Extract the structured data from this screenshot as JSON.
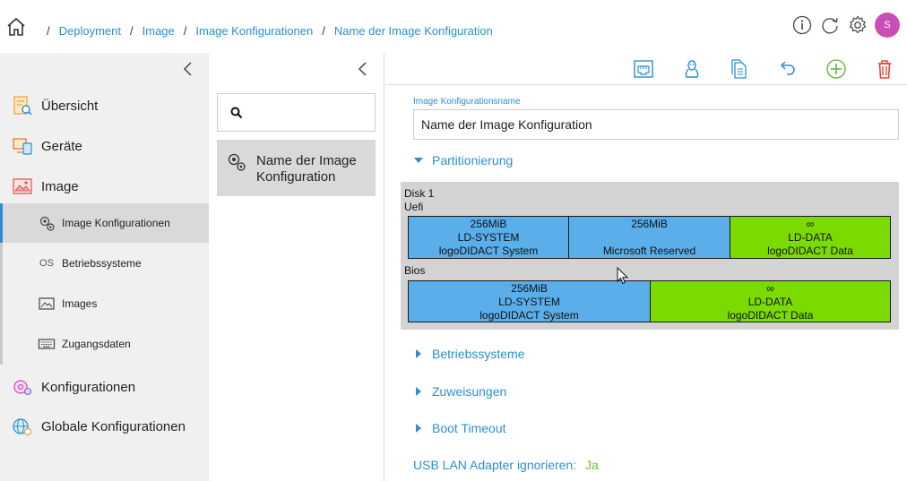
{
  "breadcrumb": {
    "items": [
      "Deployment",
      "Image",
      "Image Konfigurationen",
      "Name der Image Konfiguration"
    ],
    "separator": "/"
  },
  "header": {
    "avatar_initial": "S",
    "avatar_color": "#c94fb6"
  },
  "sidebar": {
    "items": [
      {
        "label": "Übersicht",
        "icon": "overview-icon"
      },
      {
        "label": "Geräte",
        "icon": "devices-icon"
      },
      {
        "label": "Image",
        "icon": "image-icon"
      },
      {
        "label": "Konfigurationen",
        "icon": "configurations-icon"
      },
      {
        "label": "Globale Konfigurationen",
        "icon": "global-configurations-icon"
      }
    ],
    "subitems": [
      {
        "label": "Image Konfigurationen",
        "icon": "gears-icon",
        "active": true
      },
      {
        "label": "Betriebssysteme",
        "icon_text": "OS"
      },
      {
        "label": "Images",
        "icon": "picture-icon"
      },
      {
        "label": "Zugangsdaten",
        "icon": "keyboard-icon"
      }
    ]
  },
  "middle": {
    "search_value": "",
    "list_item": "Name der Image Konfiguration"
  },
  "form": {
    "name_label": "Image Konfigurationsname",
    "name_value": "Name der Image Konfiguration",
    "sections": {
      "partitioning": "Partitionierung",
      "os": "Betriebssysteme",
      "assignments": "Zuweisungen",
      "boot_timeout": "Boot Timeout"
    },
    "usb_label": "USB LAN Adapter ignorieren:",
    "usb_value": "Ja"
  },
  "partitions": {
    "disk_label": "Disk 1",
    "uefi_label": "Uefi",
    "bios_label": "Bios",
    "uefi": [
      {
        "line1": "256MiB",
        "line2": "LD-SYSTEM",
        "line3": "logoDIDACT System"
      },
      {
        "line1": "256MiB",
        "line2": "",
        "line3": "Microsoft Reserved"
      },
      {
        "line1": "∞",
        "line2": "LD-DATA",
        "line3": "logoDIDACT Data"
      }
    ],
    "bios": [
      {
        "line1": "256MiB",
        "line2": "LD-SYSTEM",
        "line3": "logoDIDACT System"
      },
      {
        "line1": "∞",
        "line2": "LD-DATA",
        "line3": "logoDIDACT Data"
      }
    ]
  },
  "colors": {
    "accent": "#2a8fd0",
    "partition_blue": "#5aaeea",
    "partition_green": "#7bdb00",
    "add_green": "#6cc24a",
    "delete_red": "#e0463a"
  }
}
